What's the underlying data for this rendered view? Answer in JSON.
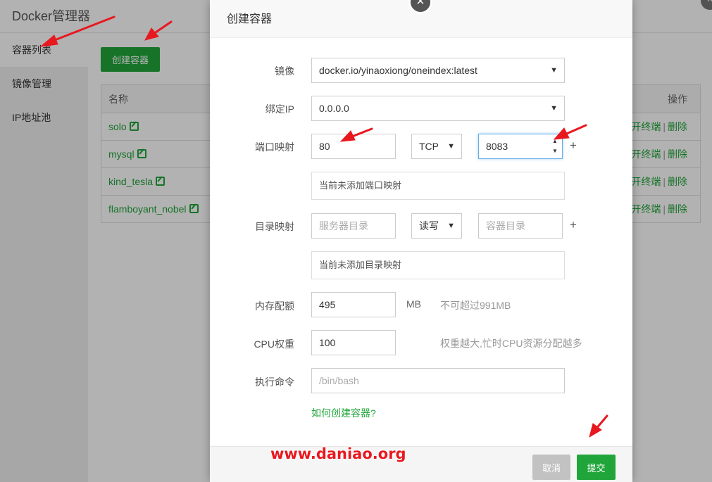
{
  "app": {
    "title": "Docker管理器",
    "sidebar": [
      {
        "label": "容器列表"
      },
      {
        "label": "镜像管理"
      },
      {
        "label": "IP地址池"
      }
    ],
    "create_button": "创建容器",
    "table": {
      "headers": {
        "name": "名称",
        "ops": "操作"
      },
      "rows": [
        {
          "name": "solo",
          "terminal": "开终端",
          "delete": "删除"
        },
        {
          "name": "mysql",
          "terminal": "开终端",
          "delete": "删除"
        },
        {
          "name": "kind_tesla",
          "terminal": "开终端",
          "delete": "删除"
        },
        {
          "name": "flamboyant_nobel",
          "terminal": "开终端",
          "delete": "删除"
        }
      ]
    }
  },
  "modal": {
    "title": "创建容器",
    "close_icon": "×",
    "image": {
      "label": "镜像",
      "value": "docker.io/yinaoxiong/oneindex:latest"
    },
    "bind_ip": {
      "label": "绑定IP",
      "value": "0.0.0.0"
    },
    "port_map": {
      "label": "端口映射",
      "host_port": "80",
      "protocol": "TCP",
      "container_port": "8083",
      "plus": "+",
      "empty_text": "当前未添加端口映射"
    },
    "dir_map": {
      "label": "目录映射",
      "server_dir_placeholder": "服务器目录",
      "mode": "读写",
      "container_dir_placeholder": "容器目录",
      "plus": "+",
      "empty_text": "当前未添加目录映射"
    },
    "memory": {
      "label": "内存配额",
      "value": "495",
      "unit": "MB",
      "hint": "不可超过991MB"
    },
    "cpu": {
      "label": "CPU权重",
      "value": "100",
      "hint": "权重越大,忙时CPU资源分配越多"
    },
    "command": {
      "label": "执行命令",
      "placeholder": "/bin/bash"
    },
    "help_link": "如何创建容器?",
    "cancel": "取消",
    "submit": "提交"
  },
  "watermark": "www.daniao.org",
  "colors": {
    "accent": "#20a53a",
    "annotation": "#e8181f"
  }
}
